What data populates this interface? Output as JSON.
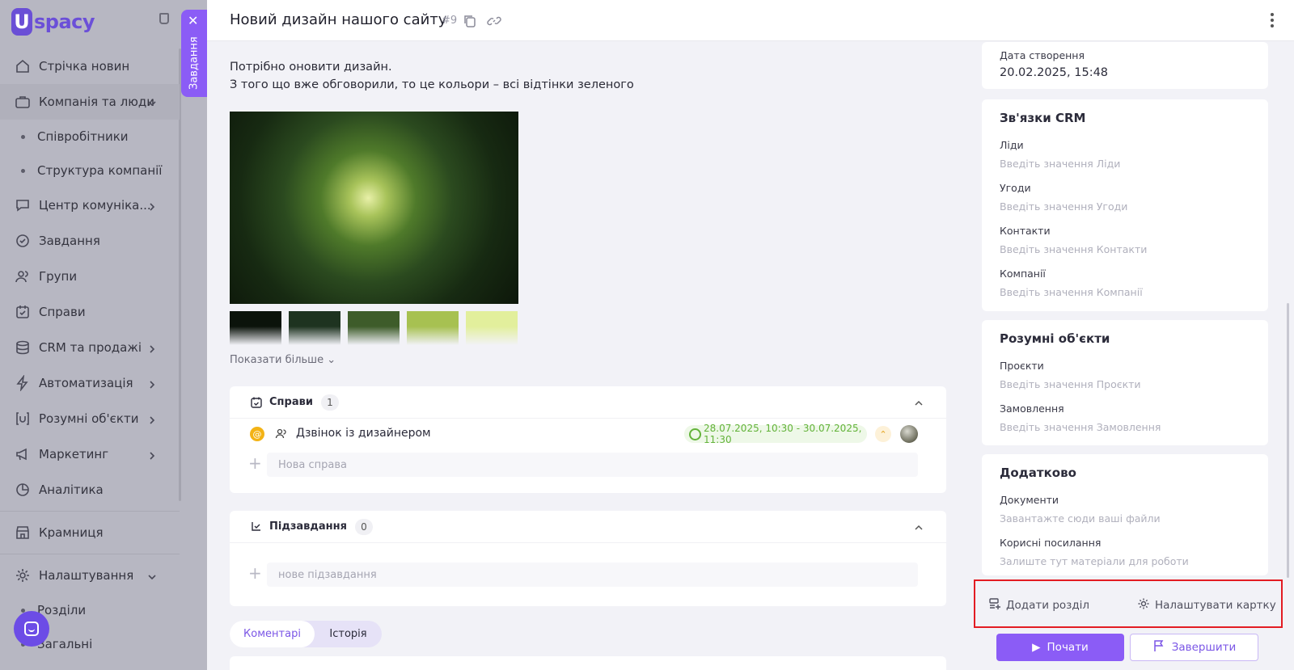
{
  "app": {
    "logo_letter": "U",
    "logo_text": "spacy"
  },
  "sidebar": {
    "items": [
      {
        "label": "Стрічка новин",
        "icon": "home-icon"
      },
      {
        "label": "Компанія та люди",
        "icon": "briefcase-icon"
      },
      {
        "label": "Співробітники"
      },
      {
        "label": "Структура компанії"
      },
      {
        "label": "Центр комуніка...",
        "icon": "chat-icon"
      },
      {
        "label": "Завдання",
        "icon": "check-circle-icon"
      },
      {
        "label": "Групи",
        "icon": "users-icon"
      },
      {
        "label": "Справи",
        "icon": "calendar-check-icon"
      },
      {
        "label": "CRM та продажі",
        "icon": "database-icon"
      },
      {
        "label": "Автоматизація",
        "icon": "lightning-icon"
      },
      {
        "label": "Розумні об'єкти",
        "icon": "smart-object-icon"
      },
      {
        "label": "Маркетинг",
        "icon": "megaphone-icon"
      },
      {
        "label": "Аналітика",
        "icon": "pie-chart-icon"
      },
      {
        "label": "Крамниця",
        "icon": "store-icon"
      },
      {
        "label": "Налаштування",
        "icon": "gear-icon"
      },
      {
        "label": "Розділи"
      },
      {
        "label": "Загальні"
      }
    ]
  },
  "side_tab": {
    "label": "Завдання"
  },
  "task": {
    "title": "Новий дизайн нашого сайту",
    "number": "#9",
    "description_line1": "Потрібно оновити дизайн.",
    "description_line2": "З того що вже обговорили, то це кольори – всі відтінки зеленого",
    "show_more": "Показати більше",
    "swatch_colors": [
      "#0b130b",
      "#1e3320",
      "#3e5c2a",
      "#a7c151",
      "#e2ef9c"
    ]
  },
  "deals": {
    "title": "Справи",
    "count": "1",
    "item": {
      "label": "Дзвінок із дизайнером",
      "date_range": "28.07.2025, 10:30 - 30.07.2025, 11:30"
    },
    "new_placeholder": "Нова справа"
  },
  "subtasks": {
    "title": "Підзавдання",
    "count": "0",
    "new_placeholder": "нове підзавдання"
  },
  "tabs": {
    "comments": "Коментарі",
    "history": "Історія"
  },
  "right": {
    "created_label": "Дата створення",
    "created_value": "20.02.2025, 15:48",
    "crm": {
      "title": "Зв'язки CRM",
      "fields": [
        {
          "label": "Ліди",
          "placeholder": "Введіть значення Ліди"
        },
        {
          "label": "Угоди",
          "placeholder": "Введіть значення Угоди"
        },
        {
          "label": "Контакти",
          "placeholder": "Введіть значення Контакти"
        },
        {
          "label": "Компанії",
          "placeholder": "Введіть значення Компанії"
        }
      ]
    },
    "smart": {
      "title": "Розумні об'єкти",
      "fields": [
        {
          "label": "Проєкти",
          "placeholder": "Введіть значення Проєкти"
        },
        {
          "label": "Замовлення",
          "placeholder": "Введіть значення Замовлення"
        }
      ]
    },
    "extra": {
      "title": "Додатково",
      "fields": [
        {
          "label": "Документи",
          "placeholder": "Завантажте сюди ваші файли"
        },
        {
          "label": "Корисні посилання",
          "placeholder": "Залиште тут матеріали для роботи"
        }
      ]
    },
    "add_section": "Додати розділ",
    "configure_card": "Налаштувати картку",
    "start": "Почати",
    "finish": "Завершити"
  },
  "colors": {
    "accent": "#8b5cf6",
    "highlight": "#e31c23",
    "date_green": "#63b33a"
  }
}
